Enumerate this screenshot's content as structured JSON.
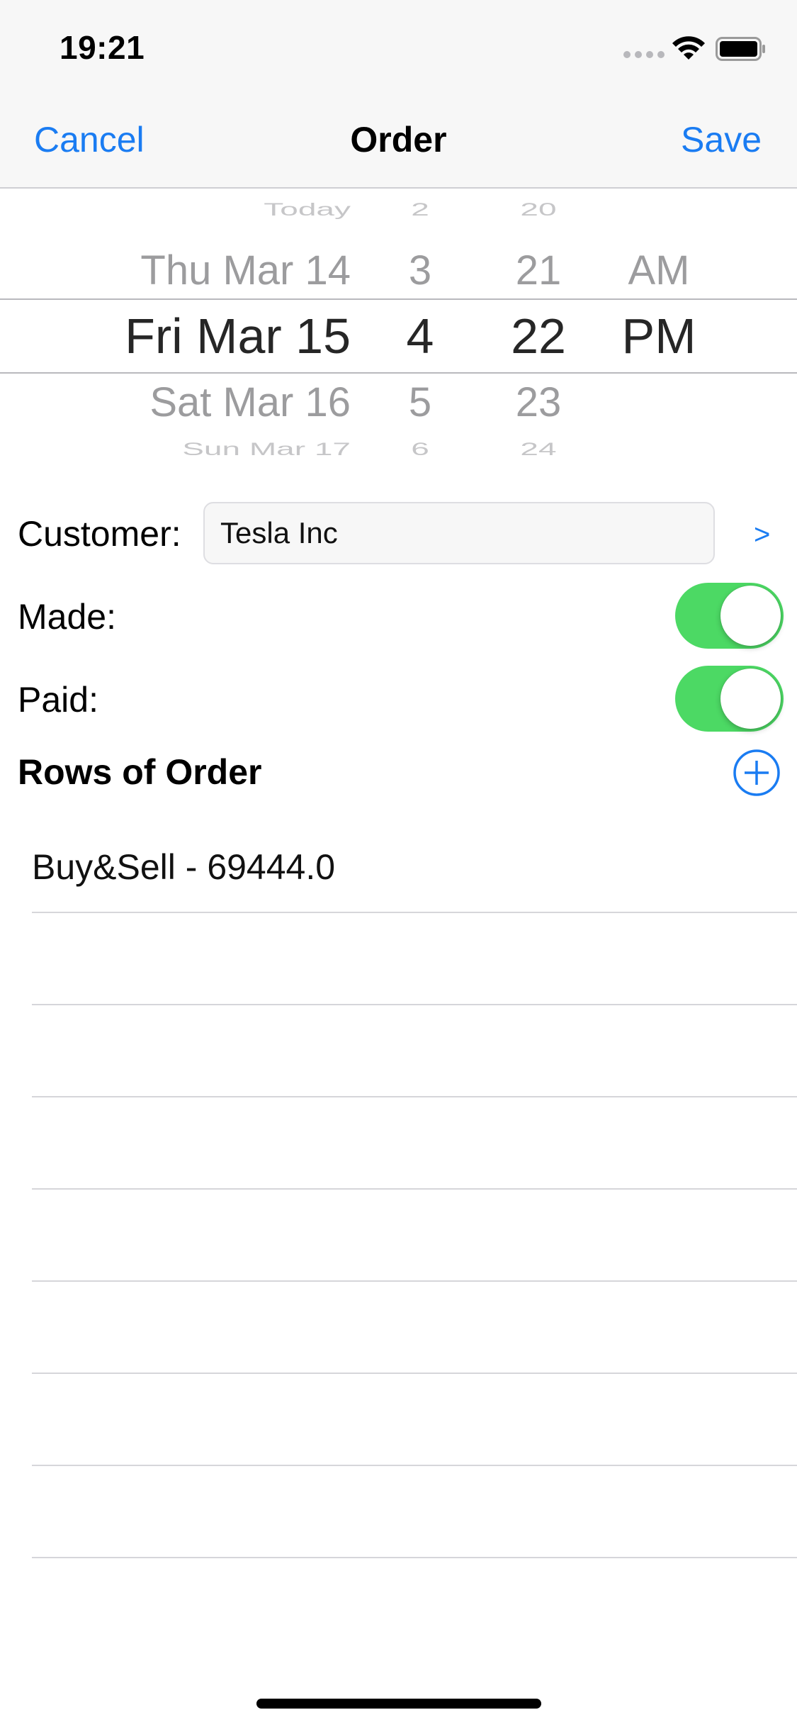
{
  "status_bar": {
    "time": "19:21",
    "icons": [
      "signal-dots-icon",
      "wifi-icon",
      "battery-icon"
    ]
  },
  "nav": {
    "cancel_label": "Cancel",
    "title": "Order",
    "save_label": "Save"
  },
  "picker": {
    "date": [
      "Today",
      "Thu Mar 14",
      "Fri Mar 15",
      "Sat Mar 16",
      "Sun Mar 17"
    ],
    "hour": [
      "2",
      "3",
      "4",
      "5",
      "6"
    ],
    "minute": [
      "20",
      "21",
      "22",
      "23",
      "24"
    ],
    "ampm": [
      "",
      "AM",
      "PM",
      "",
      ""
    ],
    "selected_index": 2
  },
  "form": {
    "customer_label": "Customer:",
    "customer_value": "Tesla Inc",
    "customer_link": ">",
    "made_label": "Made:",
    "made_on": true,
    "paid_label": "Paid:",
    "paid_on": true
  },
  "rows_section": {
    "title": "Rows of Order",
    "rows": [
      "Buy&Sell - 69444.0",
      "",
      "",
      "",
      "",
      "",
      "",
      ""
    ]
  },
  "colors": {
    "accent": "#1a7cf2",
    "toggle_on": "#4cd964",
    "nav_background": "#f7f7f7"
  }
}
